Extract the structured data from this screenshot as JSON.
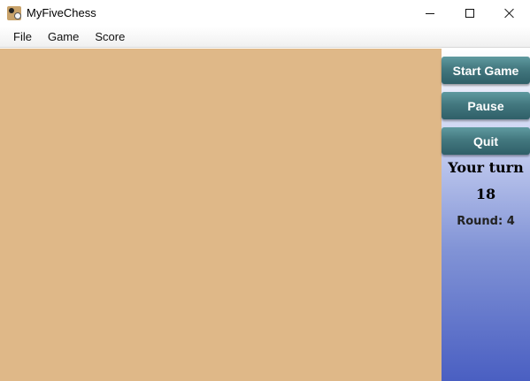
{
  "window": {
    "title": "MyFiveChess",
    "icon": "chess-app-icon"
  },
  "controls": {
    "minimize_icon": "minimize-icon",
    "maximize_icon": "maximize-icon",
    "close_icon": "close-icon"
  },
  "menu": {
    "items": [
      {
        "label": "File"
      },
      {
        "label": "Game"
      },
      {
        "label": "Score"
      }
    ]
  },
  "colors": {
    "board": "#dfb888",
    "button": "#43787f",
    "panel_top": "#ffffff",
    "panel_bottom": "#4a5fc2"
  },
  "panel": {
    "start_label": "Start Game",
    "pause_label": "Pause",
    "quit_label": "Quit",
    "turn_text": "Your turn",
    "counter": "18",
    "round_text": "Round: 4"
  }
}
